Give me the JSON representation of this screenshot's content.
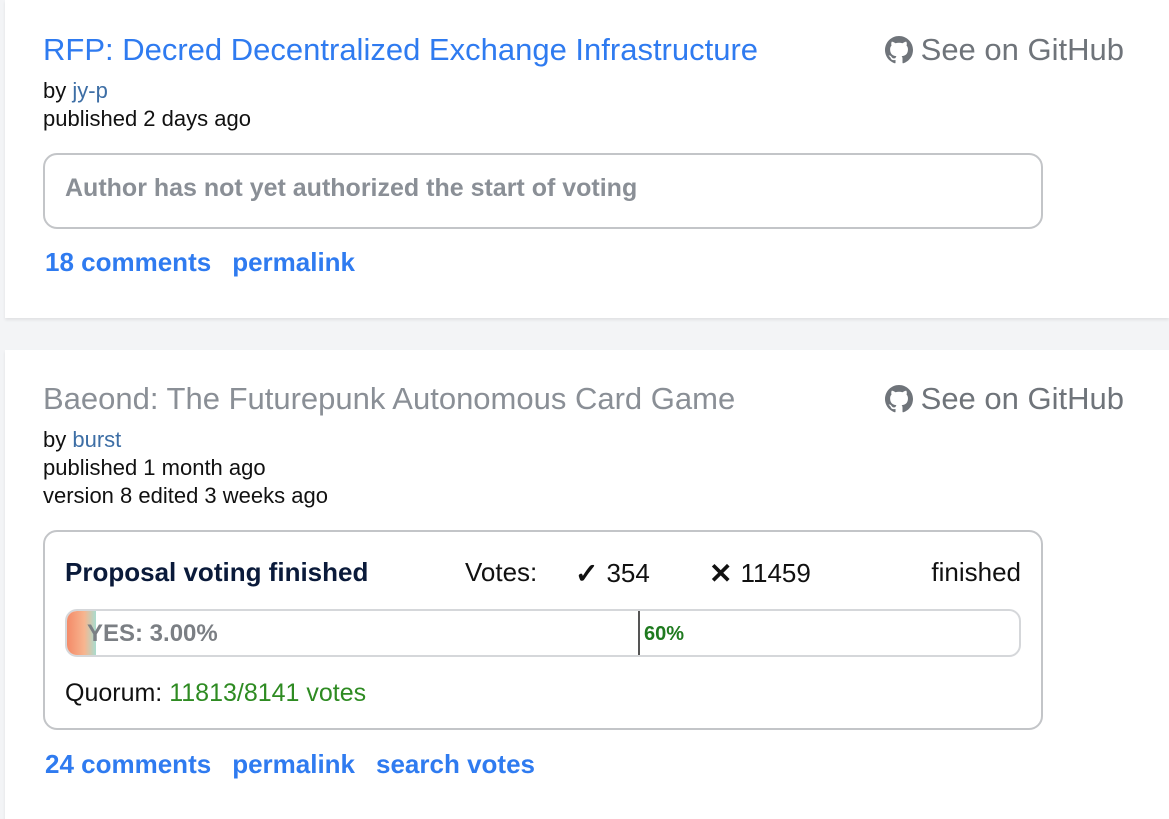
{
  "proposals": [
    {
      "title": "RFP: Decred Decentralized Exchange Infrastructure",
      "github_label": "See on GitHub",
      "by_label": "by",
      "author": "jy-p",
      "published": "published 2 days ago",
      "status_message": "Author has not yet authorized the start of voting",
      "links": [
        "18 comments",
        "permalink"
      ]
    },
    {
      "title": "Baeond: The Futurepunk Autonomous Card Game",
      "github_label": "See on GitHub",
      "by_label": "by",
      "author": "burst",
      "published": "published 1 month ago",
      "version": "version 8 edited 3 weeks ago",
      "voting": {
        "title": "Proposal voting finished",
        "votes_label": "Votes:",
        "yes_count": "354",
        "no_count": "11459",
        "state": "finished",
        "yes_label": "YES: 3.00%",
        "yes_fraction": 0.03,
        "threshold_label": "60%",
        "threshold_fraction": 0.6,
        "quorum_label": "Quorum:",
        "quorum_value": "11813/8141 votes"
      },
      "links": [
        "24 comments",
        "permalink",
        "search votes"
      ]
    }
  ],
  "icons": {
    "github": "github-icon",
    "yes": "checkmark-icon",
    "no": "cross-icon"
  },
  "colors": {
    "link": "#2f7bf0",
    "muted": "#8a8f96",
    "quorum_ok": "#2e8b22",
    "threshold": "#1f7a1f"
  }
}
